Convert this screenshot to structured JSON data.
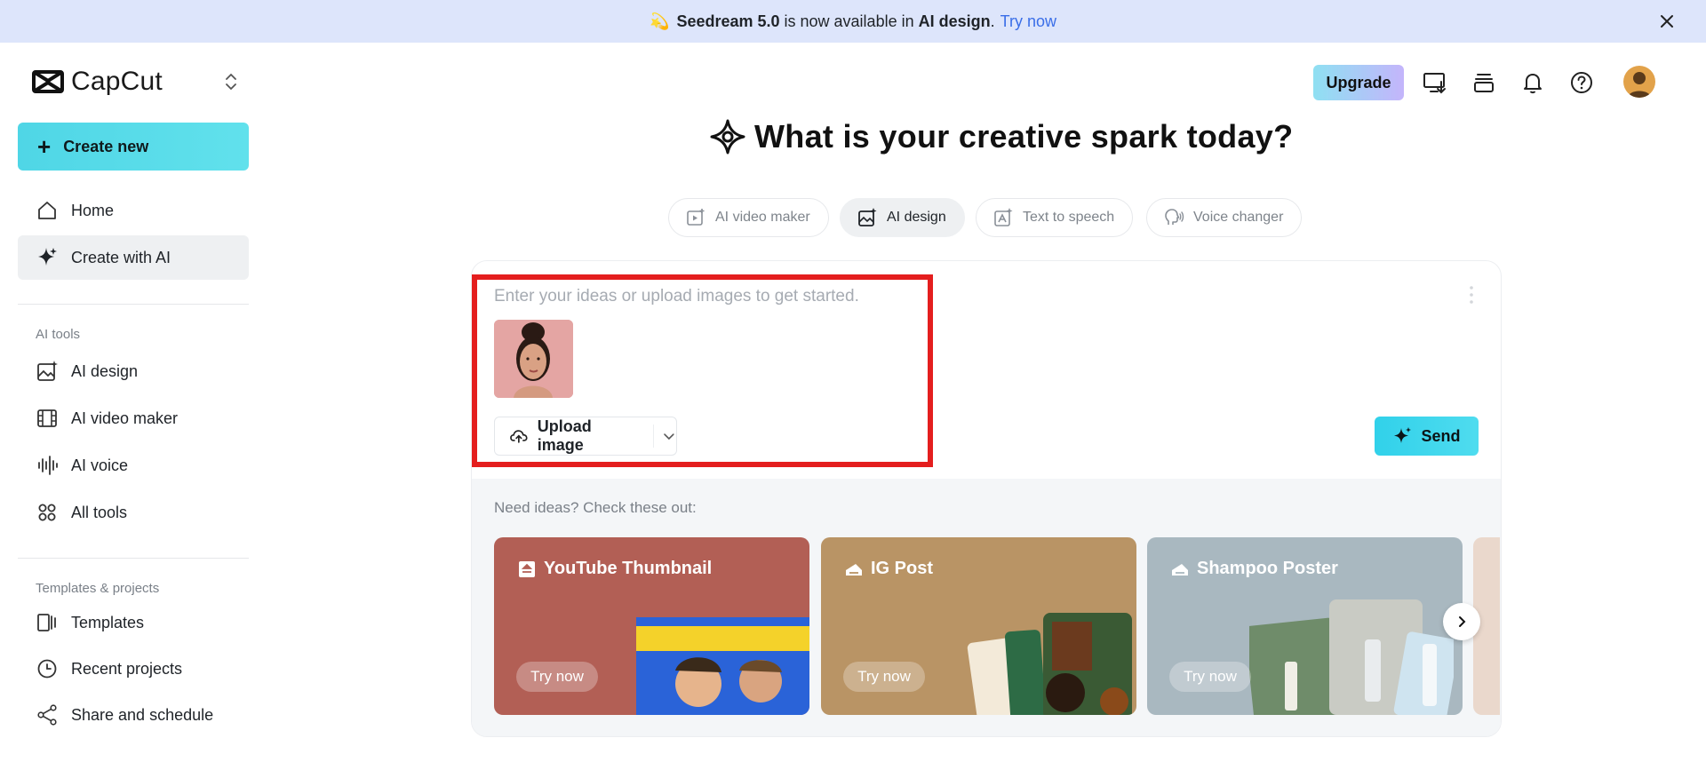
{
  "banner": {
    "product": "Seedream 5.0",
    "middle": " is now available in ",
    "feature": "AI design",
    "period": ".",
    "link": "Try now"
  },
  "sidebar": {
    "logo_text": "CapCut",
    "create_new": "Create new",
    "main_items": [
      {
        "label": "Home",
        "icon": "home-icon"
      },
      {
        "label": "Create with AI",
        "icon": "sparkle-icon"
      }
    ],
    "ai_tools_label": "AI tools",
    "ai_tools": [
      {
        "label": "AI design",
        "icon": "image-sparkle-icon"
      },
      {
        "label": "AI video maker",
        "icon": "film-icon"
      },
      {
        "label": "AI voice",
        "icon": "waveform-icon"
      },
      {
        "label": "All tools",
        "icon": "grid-icon"
      }
    ],
    "templates_label": "Templates & projects",
    "templates": [
      {
        "label": "Templates",
        "icon": "template-icon"
      },
      {
        "label": "Recent projects",
        "icon": "clock-icon"
      },
      {
        "label": "Share and schedule",
        "icon": "share-icon"
      }
    ]
  },
  "header": {
    "upgrade": "Upgrade"
  },
  "main": {
    "headline": "What is your creative spark today?",
    "tabs": [
      {
        "label": "AI video maker",
        "active": false
      },
      {
        "label": "AI design",
        "active": true
      },
      {
        "label": "Text to speech",
        "active": false
      },
      {
        "label": "Voice changer",
        "active": false
      }
    ],
    "prompt_placeholder": "Enter your ideas or upload images to get started.",
    "upload_label": "Upload image",
    "send_label": "Send",
    "ideas_label": "Need ideas? Check these out:",
    "ideas": [
      {
        "title": "YouTube Thumbnail",
        "cta": "Try now"
      },
      {
        "title": "IG Post",
        "cta": "Try now"
      },
      {
        "title": "Shampoo Poster",
        "cta": "Try now"
      }
    ]
  },
  "colors": {
    "accent": "#4fd6e6",
    "banner_bg": "#dde5fb",
    "link": "#3a6ee8",
    "highlight": "#e41e1e"
  }
}
